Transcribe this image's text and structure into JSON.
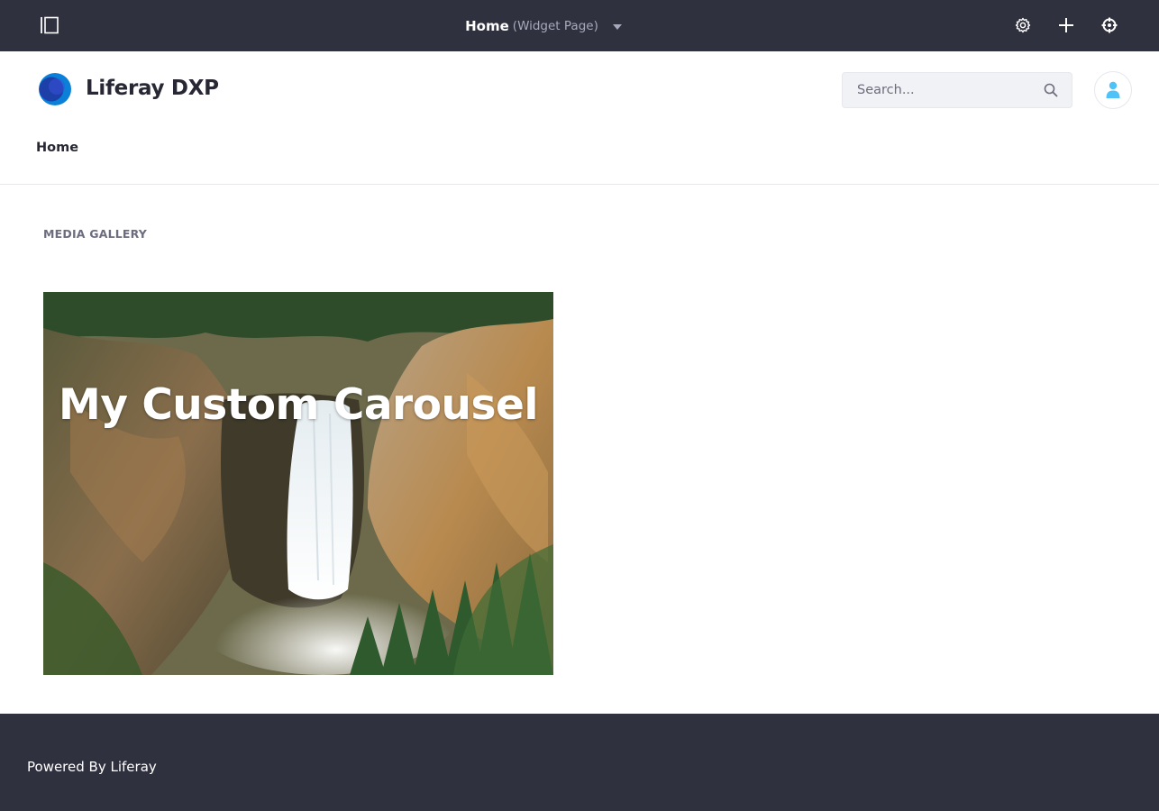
{
  "control_menu": {
    "page_name": "Home",
    "page_type": "(Widget Page)",
    "icons": [
      "product-menu-toggle-icon",
      "gear-icon",
      "plus-icon",
      "simulation-icon"
    ]
  },
  "header": {
    "site_name": "Liferay DXP",
    "search": {
      "placeholder": "Search...",
      "value": ""
    },
    "nav": [
      {
        "label": "Home"
      }
    ]
  },
  "main": {
    "portlet_title": "MEDIA GALLERY",
    "carousel": {
      "caption": "My Custom Carousel",
      "image": "waterfall-canyon"
    }
  },
  "footer": {
    "prefix": "Powered By",
    "link": "Liferay"
  },
  "colors": {
    "control_menu_bg": "#30313f",
    "footer_bg": "#30313f",
    "accent": "#0b5fff",
    "avatar_icon": "#4fc3f7"
  }
}
